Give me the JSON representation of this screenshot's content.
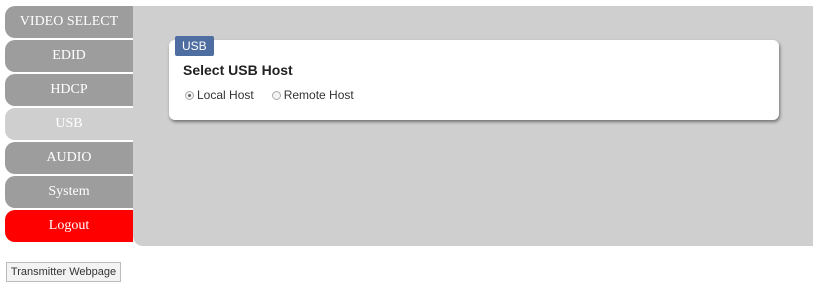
{
  "nav": {
    "items": [
      {
        "label": "VIDEO SELECT"
      },
      {
        "label": "EDID"
      },
      {
        "label": "HDCP"
      },
      {
        "label": "USB"
      },
      {
        "label": "AUDIO"
      },
      {
        "label": "System"
      },
      {
        "label": "Logout"
      }
    ],
    "active": "USB"
  },
  "usb_panel": {
    "tab_label": "USB",
    "title": "Select USB Host",
    "options": [
      {
        "label": "Local Host",
        "selected": true
      },
      {
        "label": "Remote Host",
        "selected": false
      }
    ]
  },
  "footer": {
    "transmitter_button_label": "Transmitter Webpage"
  },
  "colors": {
    "nav_default": "#9d9d9d",
    "nav_active": "#cfcfcf",
    "nav_logout": "#ff0000",
    "panel_bg": "#cfcfcf",
    "tab_bg": "#4e6da0"
  }
}
